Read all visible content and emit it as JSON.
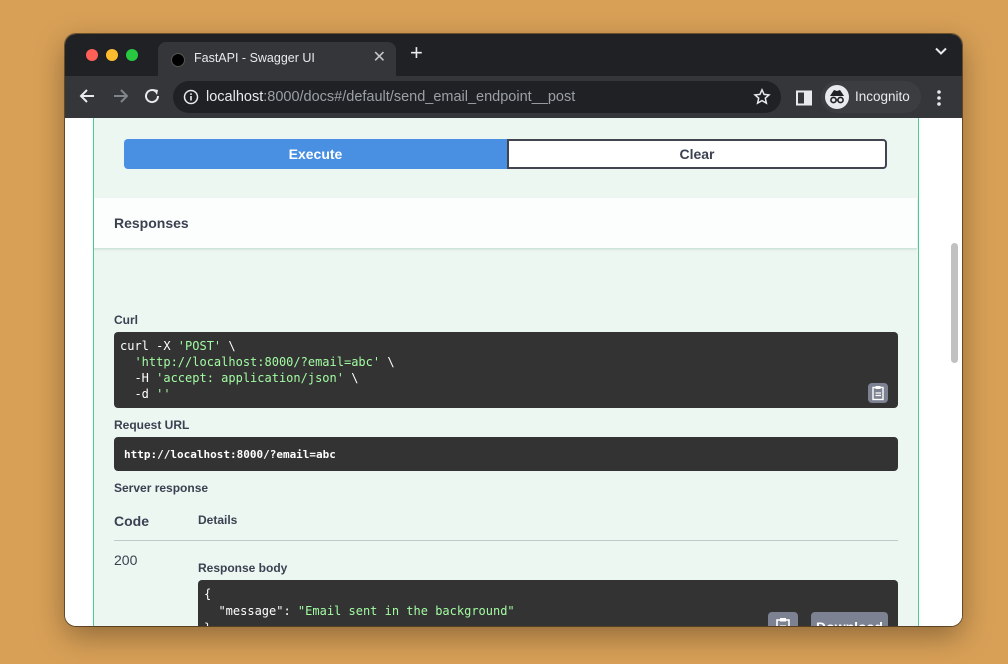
{
  "browser": {
    "tab_title": "FastAPI - Swagger UI",
    "url_host": "localhost",
    "url_rest": ":8000/docs#/default/send_email_endpoint__post",
    "incognito_label": "Incognito"
  },
  "actions": {
    "execute_label": "Execute",
    "clear_label": "Clear"
  },
  "responses": {
    "title": "Responses",
    "curl_label": "Curl",
    "curl": {
      "line1_cmd": "curl -X ",
      "line1_str": "'POST'",
      "line1_tail": " \\",
      "line2_indent": "  ",
      "line2_str": "'http://localhost:8000/?email=abc'",
      "line2_tail": " \\",
      "line3_cmd": "  -H ",
      "line3_str": "'accept: application/json'",
      "line3_tail": " \\",
      "line4_cmd": "  -d ",
      "line4_str": "''"
    },
    "request_url_label": "Request URL",
    "request_url": "http://localhost:8000/?email=abc",
    "server_response_label": "Server response",
    "col_code": "Code",
    "col_details": "Details",
    "status_code": "200",
    "response_body_label": "Response body",
    "body": {
      "open": "{",
      "key": "  \"message\": ",
      "value": "\"Email sent in the background\"",
      "close": "}"
    },
    "download_label": "Download"
  },
  "colors": {
    "execute": "#4990e2",
    "opblock_bg": "#edf7f2",
    "opblock_border": "#49cc90",
    "code_bg": "#333333",
    "code_string": "#a2fca2"
  }
}
